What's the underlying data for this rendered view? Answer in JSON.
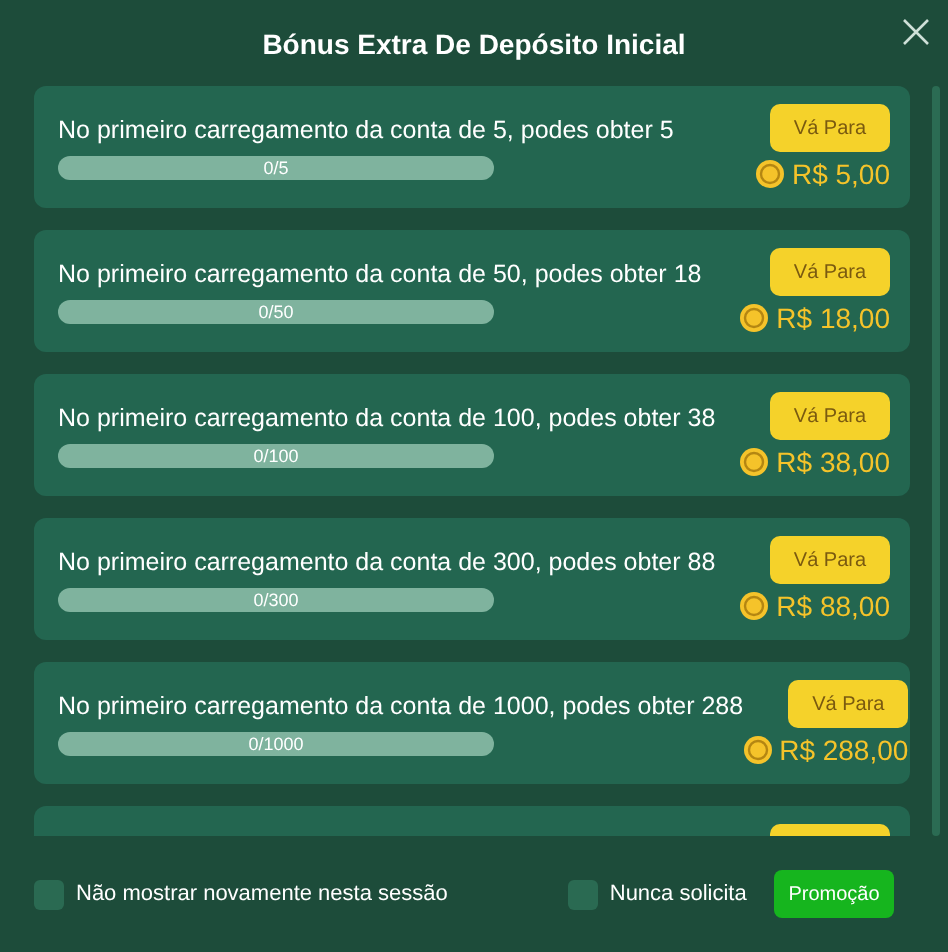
{
  "dialog": {
    "title": "Bónus Extra De Depósito Inicial"
  },
  "offers": [
    {
      "kind": "offer",
      "text": "No primeiro carregamento da conta de 5, podes obter 5",
      "progress": "0/5",
      "level": 0,
      "button": "Vá Para",
      "reward": "R$ 5,00"
    },
    {
      "kind": "offer",
      "text": "No primeiro carregamento da conta de 50, podes obter 18",
      "progress": "0/50",
      "level": 0,
      "button": "Vá Para",
      "reward": "R$ 18,00"
    },
    {
      "kind": "offer",
      "text": "No primeiro carregamento da conta de 100, podes obter 38",
      "progress": "0/100",
      "level": 0,
      "button": "Vá Para",
      "reward": "R$ 38,00"
    },
    {
      "kind": "offer",
      "text": "No primeiro carregamento da conta de 300, podes obter 88",
      "progress": "0/300",
      "level": 0,
      "button": "Vá Para",
      "reward": "R$ 88,00"
    },
    {
      "kind": "offer",
      "text": "No primeiro carregamento da conta de 1000, podes obter 288",
      "progress": "0/1000",
      "level": 0,
      "button": "Vá Para",
      "reward": "R$ 288,00"
    },
    {
      "kind": "partial"
    }
  ],
  "footer": {
    "checkboxes": [
      {
        "label": "Não mostrar novamente nesta sessão",
        "checked": false
      },
      {
        "label": "Nunca solicita",
        "checked": false
      }
    ],
    "button": "Promoção"
  }
}
